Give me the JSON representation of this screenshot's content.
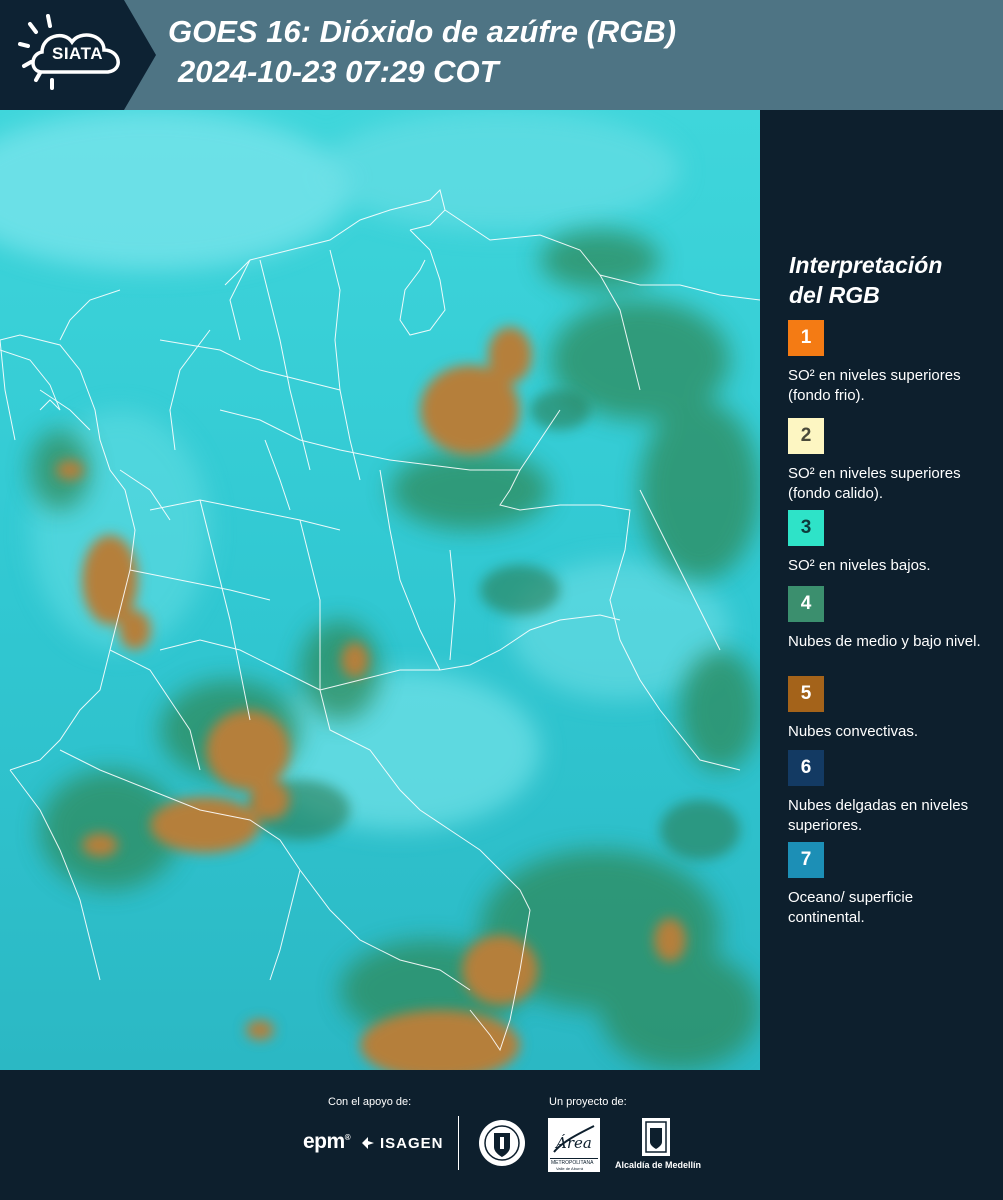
{
  "header": {
    "logo_text": "SIATA",
    "title_line1": "GOES 16: Dióxido de azúfre (RGB)",
    "title_line2": "2024-10-23 07:29 COT"
  },
  "legend": {
    "title_line1": "Interpretación",
    "title_line2": "del RGB",
    "items": [
      {
        "number": "1",
        "color": "#f47b14",
        "number_color": "#ffffff",
        "text": "SO² en niveles superiores (fondo frio)."
      },
      {
        "number": "2",
        "color": "#fdf6c2",
        "number_color": "#4a4a3a",
        "text": "SO² en niveles superiores (fondo calido)."
      },
      {
        "number": "3",
        "color": "#2ee3c8",
        "number_color": "#0d3b3b",
        "text": "SO² en niveles bajos."
      },
      {
        "number": "4",
        "color": "#3b8f6e",
        "number_color": "#ffffff",
        "text": "Nubes de medio y bajo nivel."
      },
      {
        "number": "5",
        "color": "#a4631a",
        "number_color": "#ffffff",
        "text": "Nubes convectivas."
      },
      {
        "number": "6",
        "color": "#133a63",
        "number_color": "#ffffff",
        "text": "Nubes delgadas en niveles superiores."
      },
      {
        "number": "7",
        "color": "#1c8fb6",
        "number_color": "#ffffff",
        "text": "Oceano/ superficie continental."
      }
    ]
  },
  "footer": {
    "support_label": "Con el apoyo de:",
    "project_label": "Un proyecto de:",
    "epm_text": "epm",
    "isagen_text": "ISAGEN",
    "area_text": "Área",
    "area_subtext": "METROPOLITANA",
    "area_subtext2": "Valle de Aburrá",
    "alcaldia_text": "Alcaldía de Medellín"
  },
  "colors": {
    "header_bg": "#4e7484",
    "logo_bg": "#0d2233",
    "panel_bg": "#0d1f2d",
    "map_base": "#2ec9d4",
    "cloud_green": "#2f7d55",
    "convective_brown": "#b07a35"
  }
}
